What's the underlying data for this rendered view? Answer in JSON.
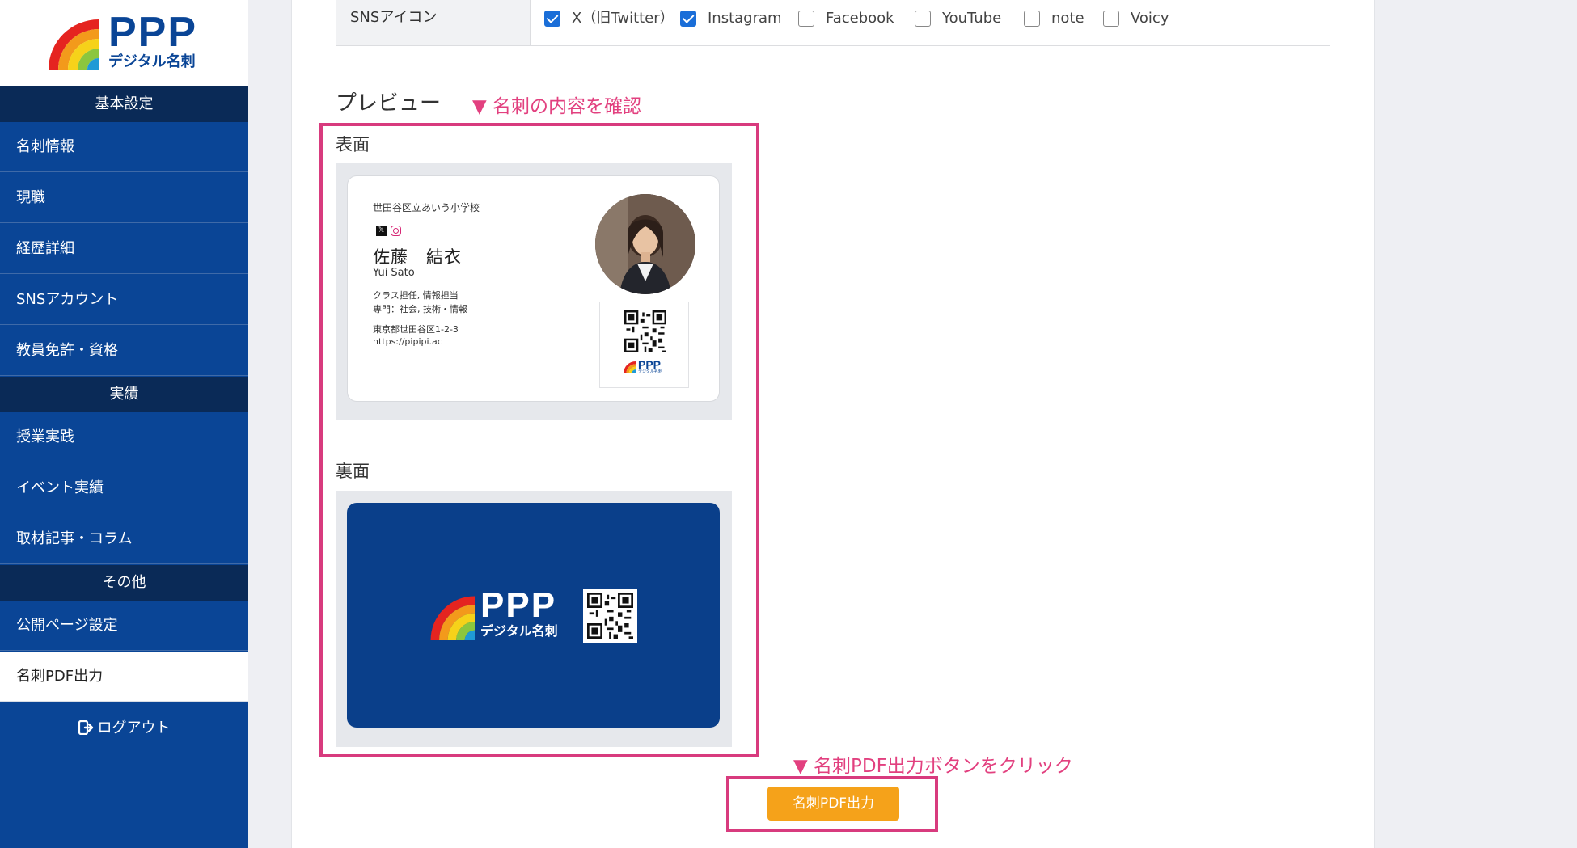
{
  "brand": {
    "logo_text": "PPP",
    "logo_sub": "デジタル名刺"
  },
  "sidebar": {
    "sections": [
      {
        "title": "基本設定",
        "items": [
          "名刺情報",
          "現職",
          "経歴詳細",
          "SNSアカウント",
          "教員免許・資格"
        ]
      },
      {
        "title": "実績",
        "items": [
          "授業実践",
          "イベント実績",
          "取材記事・コラム"
        ]
      },
      {
        "title": "その他",
        "items": [
          "公開ページ設定",
          "名刺PDF出力"
        ]
      }
    ],
    "active_item": "名刺PDF出力",
    "logout_label": "ログアウト"
  },
  "sns": {
    "label": "SNSアイコン",
    "options": [
      {
        "label": "X（旧Twitter）",
        "checked": true
      },
      {
        "label": "Instagram",
        "checked": true
      },
      {
        "label": "Facebook",
        "checked": false
      },
      {
        "label": "YouTube",
        "checked": false
      },
      {
        "label": "note",
        "checked": false
      },
      {
        "label": "Voicy",
        "checked": false
      }
    ]
  },
  "preview": {
    "title": "プレビュー",
    "annotation": "▼ 名刺の内容を確認",
    "front_label": "表面",
    "back_label": "裏面"
  },
  "card_front": {
    "school": "世田谷区立あいう小学校",
    "name": "佐藤　結衣",
    "roman": "Yui Sato",
    "role": "クラス担任, 情報担当",
    "specialty": "専門：社会, 技術・情報",
    "address": "東京都世田谷区1-2-3",
    "url": "https://pipipi.ac",
    "mini_logo_text": "PPP",
    "mini_logo_sub": "デジタル名刺"
  },
  "card_back": {
    "logo_text": "PPP",
    "logo_sub": "デジタル名刺"
  },
  "action": {
    "annotation": "▼ 名刺PDF出力ボタンをクリック",
    "button_label": "名刺PDF出力"
  },
  "colors": {
    "sidebar": "#0a4596",
    "section_header": "#0a2a57",
    "annotation": "#e2407f",
    "highlight": "#d83b7e",
    "button": "#f5a21a",
    "card_back": "#0a3f8a",
    "checkbox": "#1a6ed8"
  }
}
